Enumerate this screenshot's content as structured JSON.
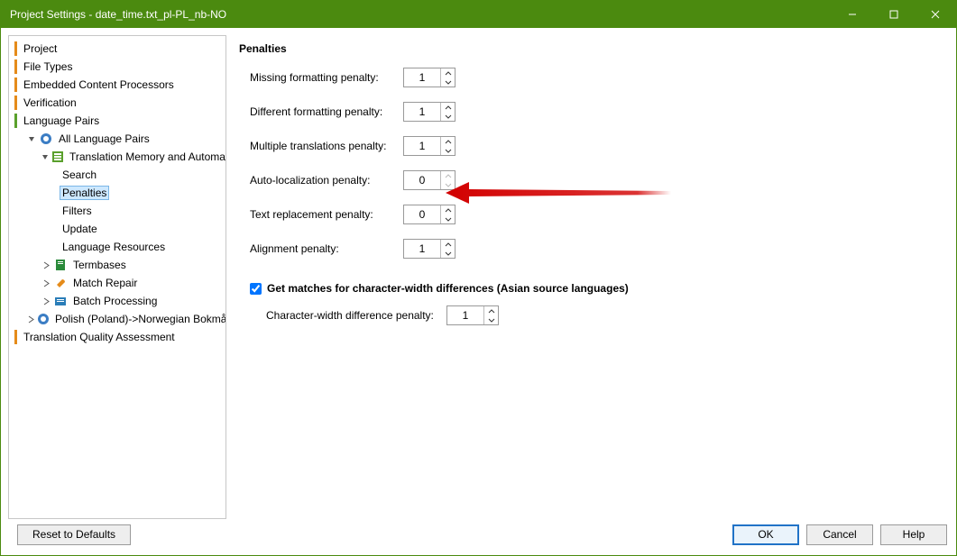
{
  "window": {
    "title": "Project Settings - date_time.txt_pl-PL_nb-NO"
  },
  "nav": {
    "project": "Project",
    "file_types": "File Types",
    "embedded": "Embedded Content Processors",
    "verification": "Verification",
    "language_pairs": "Language Pairs",
    "all_lang_pairs": "All Language Pairs",
    "tm_auto": "Translation Memory and Automated",
    "search": "Search",
    "penalties": "Penalties",
    "filters": "Filters",
    "update": "Update",
    "lang_res": "Language Resources",
    "termbases": "Termbases",
    "match_repair": "Match Repair",
    "batch": "Batch Processing",
    "polish_norw": "Polish (Poland)->Norwegian Bokmål (No",
    "tqa": "Translation Quality Assessment"
  },
  "content": {
    "heading": "Penalties",
    "missing_fmt": "Missing formatting penalty:",
    "missing_fmt_val": "1",
    "diff_fmt": "Different formatting penalty:",
    "diff_fmt_val": "1",
    "multi_trans": "Multiple translations penalty:",
    "multi_trans_val": "1",
    "auto_loc": "Auto-localization penalty:",
    "auto_loc_val": "0",
    "text_repl": "Text replacement penalty:",
    "text_repl_val": "0",
    "alignment": "Alignment penalty:",
    "alignment_val": "1",
    "checkbox": "Get matches for character-width differences (Asian source languages)",
    "char_width": "Character-width difference penalty:",
    "char_width_val": "1"
  },
  "footer": {
    "reset": "Reset to Defaults",
    "ok": "OK",
    "cancel": "Cancel",
    "help": "Help"
  }
}
